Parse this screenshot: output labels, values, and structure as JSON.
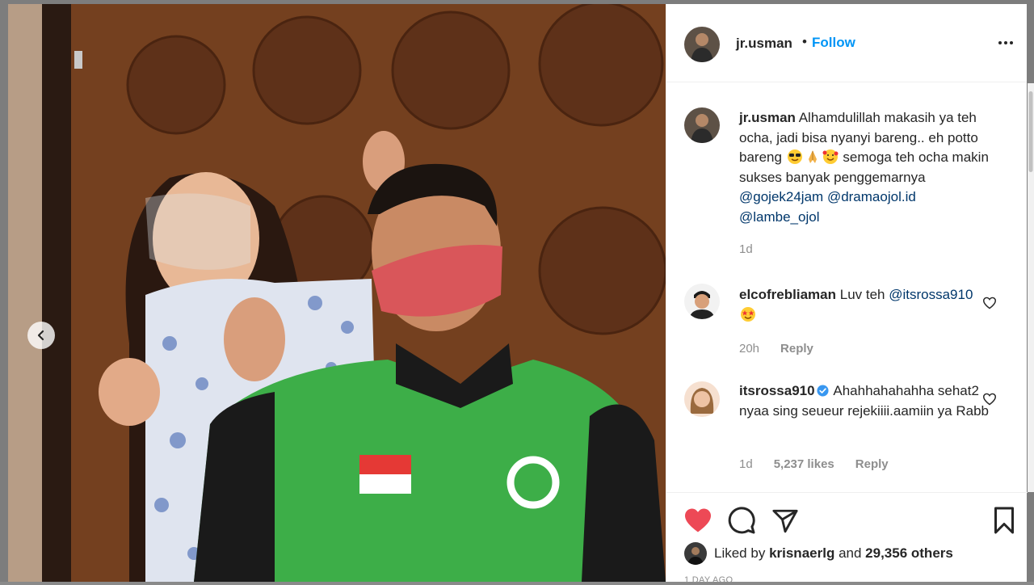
{
  "post": {
    "author": "jr.usman",
    "dot": "•",
    "follow_label": "Follow"
  },
  "caption": {
    "username": "jr.usman",
    "text_1": "Alhamdulillah makasih ya teh ocha, jadi bisa nyanyi bareng.. eh potto bareng",
    "text_2": "semoga teh ocha makin sukses banyak penggemarnya",
    "mentions": [
      "@gojek24jam",
      "@dramaojol.id",
      "@lambe_ojol"
    ],
    "time": "1d",
    "emojis": [
      "sunglasses-emoji",
      "folded-hands-emoji",
      "smiling-hearts-emoji"
    ]
  },
  "comments": [
    {
      "username": "elcofrebliaman",
      "text": "Luv teh",
      "mention": "@itsrossa910",
      "emoji": "star-struck-emoji",
      "time": "20h",
      "reply_label": "Reply"
    },
    {
      "username": "itsrossa910",
      "verified": true,
      "text": "Ahahhahahahha sehat2 nyaa sing seueur rejekiiii.aamiin ya Rabb",
      "time": "1d",
      "likes": "5,237 likes",
      "reply_label": "Reply"
    }
  ],
  "footer": {
    "liked_by": "Liked by",
    "liker": "krisnaerlg",
    "and": "and",
    "others": "29,356 others",
    "timestamp": "1 DAY AGO"
  },
  "colors": {
    "accent": "#0095f6",
    "like_red": "#ed4956",
    "mention": "#00376b",
    "muted": "#8e8e8e"
  },
  "icons": [
    "prev-arrow-icon",
    "more-options-icon",
    "heart-icon",
    "comment-icon",
    "share-icon",
    "bookmark-icon",
    "verified-badge-icon"
  ]
}
